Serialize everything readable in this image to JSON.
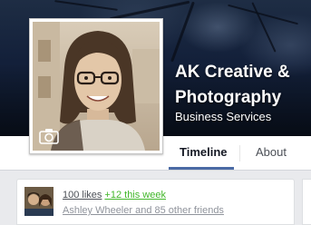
{
  "page": {
    "name": "AK Creative & Photography",
    "category": "Business Services"
  },
  "tabs": [
    {
      "label": "Timeline",
      "active": true
    },
    {
      "label": "About",
      "active": false
    }
  ],
  "likes": {
    "count_label": "100 likes",
    "weekly_change": "+12 this week",
    "friends_text": "Ashley Wheeler and 85 other friends"
  },
  "colors": {
    "active_tab_underline": "#4b6aa5",
    "weekly_change": "#42b72a",
    "cover_dark": "#13203a"
  },
  "icons": {
    "profile_camera": "camera-icon"
  }
}
